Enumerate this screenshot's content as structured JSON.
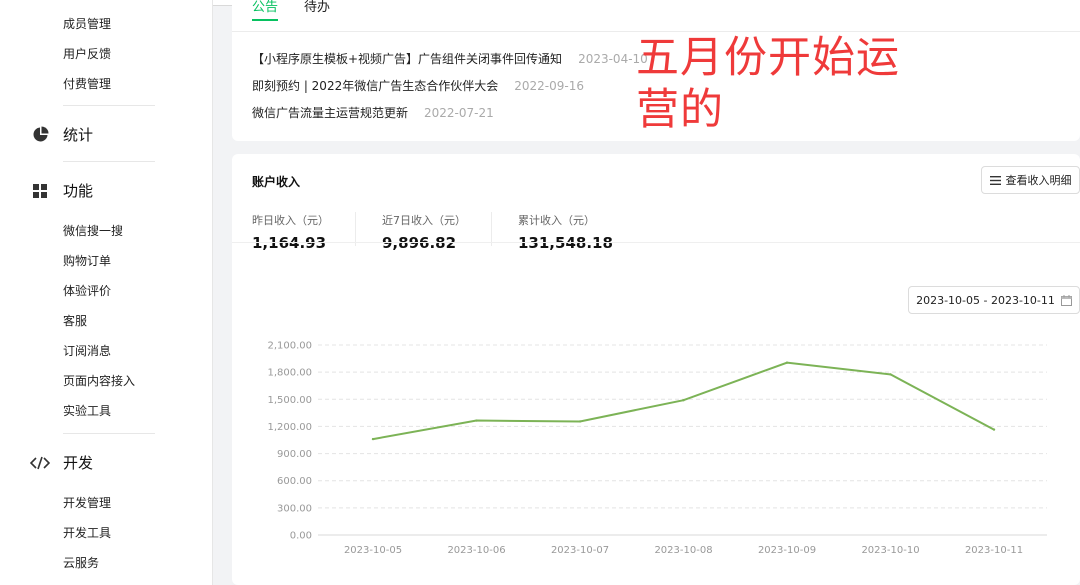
{
  "sidebar": {
    "sub_group_1": [
      "成员管理",
      "用户反馈",
      "付费管理"
    ],
    "stats_label": "统计",
    "features_label": "功能",
    "features_items": [
      "微信搜一搜",
      "购物订单",
      "体验评价",
      "客服",
      "订阅消息",
      "页面内容接入",
      "实验工具"
    ],
    "dev_label": "开发",
    "dev_items": [
      "开发管理",
      "开发工具",
      "云服务"
    ]
  },
  "announcements": {
    "tabs": [
      "公告",
      "待办"
    ],
    "items": [
      {
        "title": "【小程序原生模板+视频广告】广告组件关闭事件回传通知",
        "date": "2023-04-10"
      },
      {
        "title": "即刻预约 | 2022年微信广告生态合作伙伴大会",
        "date": "2022-09-16"
      },
      {
        "title": "微信广告流量主运营规范更新",
        "date": "2022-07-21"
      }
    ]
  },
  "overlay_text": "五月份开始运营的",
  "income": {
    "title": "账户收入",
    "detail_button": "查看收入明细",
    "stats": [
      {
        "label": "昨日收入（元）",
        "value": "1,164.93"
      },
      {
        "label": "近7日收入（元）",
        "value": "9,896.82"
      },
      {
        "label": "累计收入（元）",
        "value": "131,548.18"
      }
    ],
    "date_range": "2023-10-05 - 2023-10-11"
  },
  "colors": {
    "accent": "#07c160",
    "line": "#7cb356",
    "overlay": "#ef3a3a"
  },
  "chart_data": {
    "type": "line",
    "x": [
      "2023-10-05",
      "2023-10-06",
      "2023-10-07",
      "2023-10-08",
      "2023-10-09",
      "2023-10-10",
      "2023-10-11"
    ],
    "series": [
      {
        "values": [
          1060,
          1265,
          1255,
          1490,
          1905,
          1775,
          1165
        ]
      }
    ],
    "yticks": [
      "2,100.00",
      "1,800.00",
      "1,500.00",
      "1,200.00",
      "900.00",
      "600.00",
      "300.00",
      "0.00"
    ],
    "ylim": [
      0,
      2100
    ],
    "grid": true
  }
}
